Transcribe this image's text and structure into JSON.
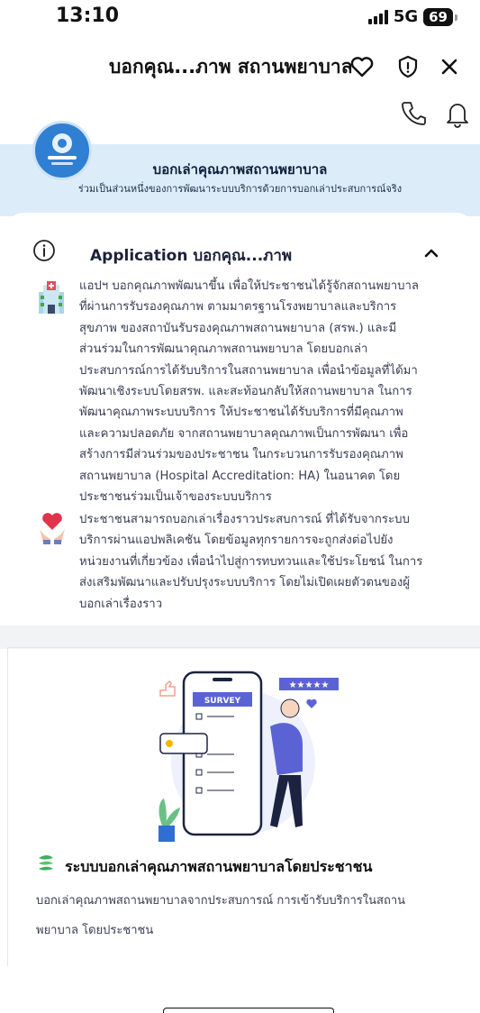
{
  "status_bar": {
    "time": "13:10",
    "network": "5G",
    "battery": "69"
  },
  "title_bar": {
    "title": "บอกคุณ...ภาพ สถานพยาบาล"
  },
  "header": {
    "title": "บอกเล่าคุณภาพสถานพยาบาล",
    "subtitle": "ร่วมเป็นส่วนหนึ่งของการพัฒนาระบบบริการด้วยการบอกเล่าประสบการณ์จริง"
  },
  "info_section": {
    "title": "Application บอกคุณ...ภาพ",
    "paragraph1_lines": [
      "แอปฯ บอกคุณภาพพัฒนาขึ้น เพื่อให้ประชาชนได้รู้จักสถานพยาบาล",
      "ที่ผ่านการรับรองคุณภาพ ตามมาตรฐานโรงพยาบาลและบริการ",
      "สุขภาพ ของสถาบันรับรองคุณภาพสถานพยาบาล (สรพ.) และมี",
      "ส่วนร่วมในการพัฒนาคุณภาพสถานพยาบาล โดยบอกเล่า",
      "ประสบการณ์การได้รับบริการในสถานพยาบาล เพื่อนำข้อมูลที่ได้มา",
      "พัฒนาเชิงระบบโดยสรพ. และสะท้อนกลับให้สถานพยาบาล ในการ",
      "พัฒนาคุณภาพระบบบริการ ให้ประชาชนได้รับบริการที่มีคุณภาพ",
      "และความปลอดภัย จากสถานพยาบาลคุณภาพเป็นการพัฒนา เพื่อ",
      "สร้างการมีส่วนร่วมของประชาชน ในกระบวนการรับรองคุณภาพ",
      "สถานพยาบาล (Hospital Accreditation: HA) ในอนาคต โดย",
      "ประชาชนร่วมเป็นเจ้าของระบบบริการ"
    ],
    "paragraph2_lines": [
      "ประชาชนสามารถบอกเล่าเรื่องราวประสบการณ์ ที่ได้รับจากระบบ",
      "บริการผ่านแอปพลิเคชัน โดยข้อมูลทุกรายการจะถูกส่งต่อไปยัง",
      "หน่วยงานที่เกี่ยวข้อง เพื่อนำไปสู่การทบทวนและใช้ประโยชน์ ในการ",
      "ส่งเสริมพัฒนาและปรับปรุงระบบบริการ โดยไม่เปิดเผยตัวตนของผู้",
      "บอกเล่าเรื่องราว"
    ]
  },
  "feature": {
    "survey_label": "SURVEY",
    "title": "ระบบบอกเล่าคุณภาพสถานพยาบาลโดยประชาชน",
    "description_lines": [
      "บอกเล่าคุณภาพสถานพยาบาลจากประสบการณ์ การเข้ารับบริการในสถาน",
      "พยาบาล โดยประชาชน"
    ]
  },
  "icons": {
    "favorite": "heart-icon",
    "security": "shield-icon",
    "close": "close-icon",
    "call": "phone-icon",
    "notifications": "bell-icon",
    "info": "info-icon",
    "collapse": "chevron-up-icon"
  },
  "colors": {
    "banner_bg": "#dcecf9",
    "accent_blue": "#2f7fd3"
  }
}
